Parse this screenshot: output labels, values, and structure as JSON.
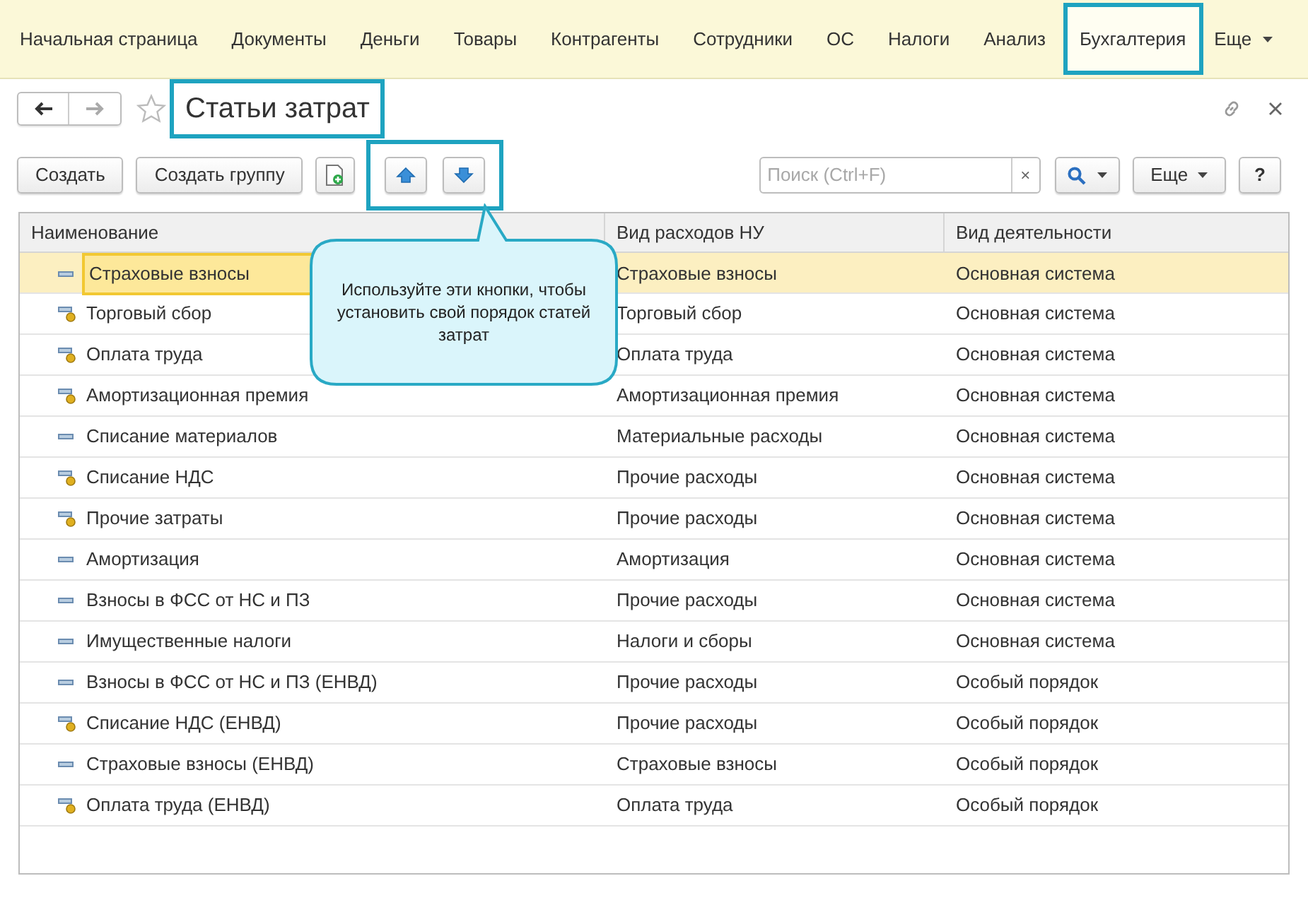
{
  "nav": {
    "items": [
      {
        "label": "Начальная страница",
        "selected": false,
        "highlighted": false
      },
      {
        "label": "Документы",
        "selected": false,
        "highlighted": false
      },
      {
        "label": "Деньги",
        "selected": false,
        "highlighted": false
      },
      {
        "label": "Товары",
        "selected": false,
        "highlighted": false
      },
      {
        "label": "Контрагенты",
        "selected": false,
        "highlighted": false
      },
      {
        "label": "Сотрудники",
        "selected": false,
        "highlighted": false
      },
      {
        "label": "ОС",
        "selected": false,
        "highlighted": false
      },
      {
        "label": "Налоги",
        "selected": false,
        "highlighted": false
      },
      {
        "label": "Анализ",
        "selected": false,
        "highlighted": false
      },
      {
        "label": "Бухгалтерия",
        "selected": true,
        "highlighted": true
      }
    ],
    "more": "Еще"
  },
  "title": {
    "text": "Статьи затрат",
    "highlighted": true
  },
  "toolbar": {
    "create": "Создать",
    "create_group": "Создать группу",
    "reorder_highlighted": true,
    "search_placeholder": "Поиск (Ctrl+F)",
    "clear": "×",
    "more": "Еще",
    "help": "?"
  },
  "callout": "Используйте эти кнопки, чтобы установить свой порядок статей затрат",
  "table": {
    "columns": [
      "Наименование",
      "Вид расходов НУ",
      "Вид деятельности"
    ],
    "rows": [
      {
        "kind": "predefined",
        "selected": true,
        "cells": [
          "Страховые взносы",
          "Страховые взносы",
          "Основная система"
        ]
      },
      {
        "kind": "user",
        "selected": false,
        "cells": [
          "Торговый сбор",
          "Торговый сбор",
          "Основная система"
        ]
      },
      {
        "kind": "user",
        "selected": false,
        "cells": [
          "Оплата труда",
          "Оплата труда",
          "Основная система"
        ]
      },
      {
        "kind": "user",
        "selected": false,
        "cells": [
          "Амортизационная премия",
          "Амортизационная премия",
          "Основная система"
        ]
      },
      {
        "kind": "predefined",
        "selected": false,
        "cells": [
          "Списание материалов",
          "Материальные расходы",
          "Основная система"
        ]
      },
      {
        "kind": "user",
        "selected": false,
        "cells": [
          "Списание НДС",
          "Прочие расходы",
          "Основная система"
        ]
      },
      {
        "kind": "user",
        "selected": false,
        "cells": [
          "Прочие затраты",
          "Прочие расходы",
          "Основная система"
        ]
      },
      {
        "kind": "predefined",
        "selected": false,
        "cells": [
          "Амортизация",
          "Амортизация",
          "Основная система"
        ]
      },
      {
        "kind": "predefined",
        "selected": false,
        "cells": [
          "Взносы в ФСС от НС и ПЗ",
          "Прочие расходы",
          "Основная система"
        ]
      },
      {
        "kind": "predefined",
        "selected": false,
        "cells": [
          "Имущественные налоги",
          "Налоги и сборы",
          "Основная система"
        ]
      },
      {
        "kind": "predefined",
        "selected": false,
        "cells": [
          "Взносы в ФСС от НС и ПЗ (ЕНВД)",
          "Прочие расходы",
          "Особый порядок"
        ]
      },
      {
        "kind": "user",
        "selected": false,
        "cells": [
          "Списание НДС (ЕНВД)",
          "Прочие расходы",
          "Особый порядок"
        ]
      },
      {
        "kind": "predefined",
        "selected": false,
        "cells": [
          "Страховые взносы (ЕНВД)",
          "Страховые взносы",
          "Особый порядок"
        ]
      },
      {
        "kind": "user",
        "selected": false,
        "cells": [
          "Оплата труда (ЕНВД)",
          "Оплата труда",
          "Особый порядок"
        ]
      }
    ]
  }
}
